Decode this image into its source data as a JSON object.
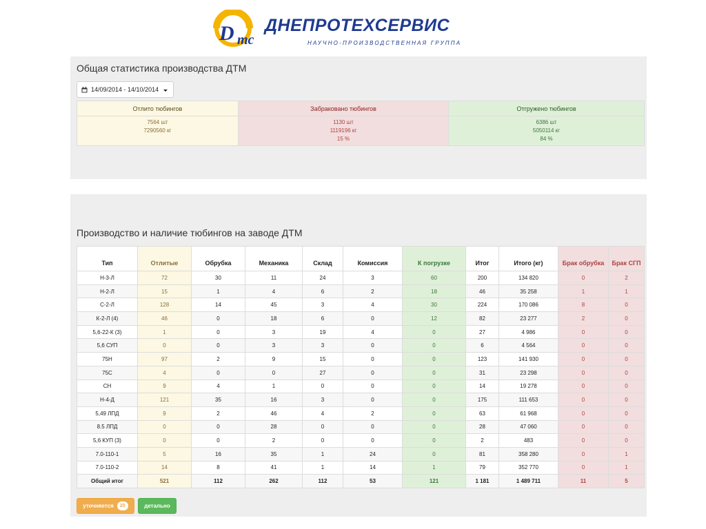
{
  "header": {
    "logo_mark_text": "DTS",
    "company_name": "ДНЕПРОТЕХСЕРВИС",
    "company_subtitle": "НАУЧНО-ПРОИЗВОДСТВЕННАЯ ГРУППА",
    "brand_color": "#1f3a8f",
    "mark_color": "#f5b400"
  },
  "stats_panel": {
    "title": "Общая статистика производства ДТМ",
    "date_range": "14/09/2014 - 14/10/2014",
    "columns": [
      {
        "label": "Отлито тюбингов",
        "lines": [
          "7564 шт",
          "7290560 кг"
        ]
      },
      {
        "label": "Забраковано тюбингов",
        "lines": [
          "1130 шт",
          "1119196 кг",
          "15 %"
        ]
      },
      {
        "label": "Отгружено тюбингов",
        "lines": [
          "6386 шт",
          "5050114 кг",
          "84 %"
        ]
      }
    ]
  },
  "production_panel": {
    "title": "Производство и наличие тюбингов на заводе ДТМ",
    "headers": [
      "Тип",
      "Отлитые",
      "Обрубка",
      "Механика",
      "Склад",
      "Комиссия",
      "К погрузке",
      "Итог",
      "Итого (кг)",
      "Брак обрубка",
      "Брак СГП"
    ],
    "rows": [
      [
        "Н-3-Л",
        "72",
        "30",
        "11",
        "24",
        "3",
        "60",
        "200",
        "134 820",
        "0",
        "2"
      ],
      [
        "Н-2-Л",
        "15",
        "1",
        "4",
        "6",
        "2",
        "18",
        "46",
        "35 258",
        "1",
        "1"
      ],
      [
        "С-2-Л",
        "128",
        "14",
        "45",
        "3",
        "4",
        "30",
        "224",
        "170 086",
        "8",
        "0"
      ],
      [
        "К-2-Л (4)",
        "46",
        "0",
        "18",
        "6",
        "0",
        "12",
        "82",
        "23 277",
        "2",
        "0"
      ],
      [
        "5,6-22-К (3)",
        "1",
        "0",
        "3",
        "19",
        "4",
        "0",
        "27",
        "4 986",
        "0",
        "0"
      ],
      [
        "5,6 СУП",
        "0",
        "0",
        "3",
        "3",
        "0",
        "0",
        "6",
        "4 564",
        "0",
        "0"
      ],
      [
        "75Н",
        "97",
        "2",
        "9",
        "15",
        "0",
        "0",
        "123",
        "141 930",
        "0",
        "0"
      ],
      [
        "75С",
        "4",
        "0",
        "0",
        "27",
        "0",
        "0",
        "31",
        "23 298",
        "0",
        "0"
      ],
      [
        "СН",
        "9",
        "4",
        "1",
        "0",
        "0",
        "0",
        "14",
        "19 278",
        "0",
        "0"
      ],
      [
        "Н-4-Д",
        "121",
        "35",
        "16",
        "3",
        "0",
        "0",
        "175",
        "111 653",
        "0",
        "0"
      ],
      [
        "5,49 ЛПД",
        "9",
        "2",
        "46",
        "4",
        "2",
        "0",
        "63",
        "61 968",
        "0",
        "0"
      ],
      [
        "8.5 ЛПД",
        "0",
        "0",
        "28",
        "0",
        "0",
        "0",
        "28",
        "47 060",
        "0",
        "0"
      ],
      [
        "5,6 КУП (3)",
        "0",
        "0",
        "2",
        "0",
        "0",
        "0",
        "2",
        "483",
        "0",
        "0"
      ],
      [
        "7.0-110-1",
        "5",
        "16",
        "35",
        "1",
        "24",
        "0",
        "81",
        "358 280",
        "0",
        "1"
      ],
      [
        "7.0-110-2",
        "14",
        "8",
        "41",
        "1",
        "14",
        "1",
        "79",
        "352 770",
        "0",
        "1"
      ]
    ],
    "total": [
      "Общий итог",
      "521",
      "112",
      "262",
      "112",
      "53",
      "121",
      "1 181",
      "1 489 711",
      "11",
      "5"
    ],
    "buttons": {
      "pending_label": "уточняется",
      "pending_count": "20",
      "details_label": "детально"
    }
  }
}
